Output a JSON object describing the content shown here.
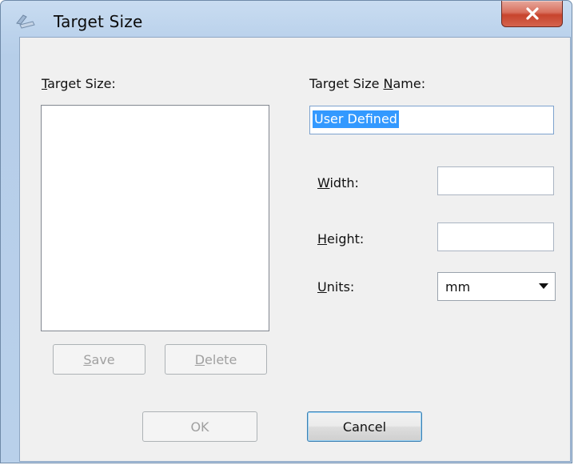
{
  "window": {
    "title": "Target Size",
    "close_symbol": "X",
    "icon": "scanner-icon"
  },
  "left_panel": {
    "label_accel": "T",
    "label_rest": "arget Size:",
    "items": [],
    "save_accel": "S",
    "save_rest": "ave",
    "delete_accel": "D",
    "delete_rest": "elete"
  },
  "right_panel": {
    "name_label_pre": "Target Size ",
    "name_label_accel": "N",
    "name_label_post": "ame:",
    "name_value": "User Defined",
    "width_accel": "W",
    "width_rest": "idth:",
    "width_value": "",
    "height_accel": "H",
    "height_rest": "eight:",
    "height_value": "",
    "units_accel": "U",
    "units_rest": "nits:",
    "units_value": "mm"
  },
  "footer": {
    "ok_label": "OK",
    "cancel_label": "Cancel"
  }
}
